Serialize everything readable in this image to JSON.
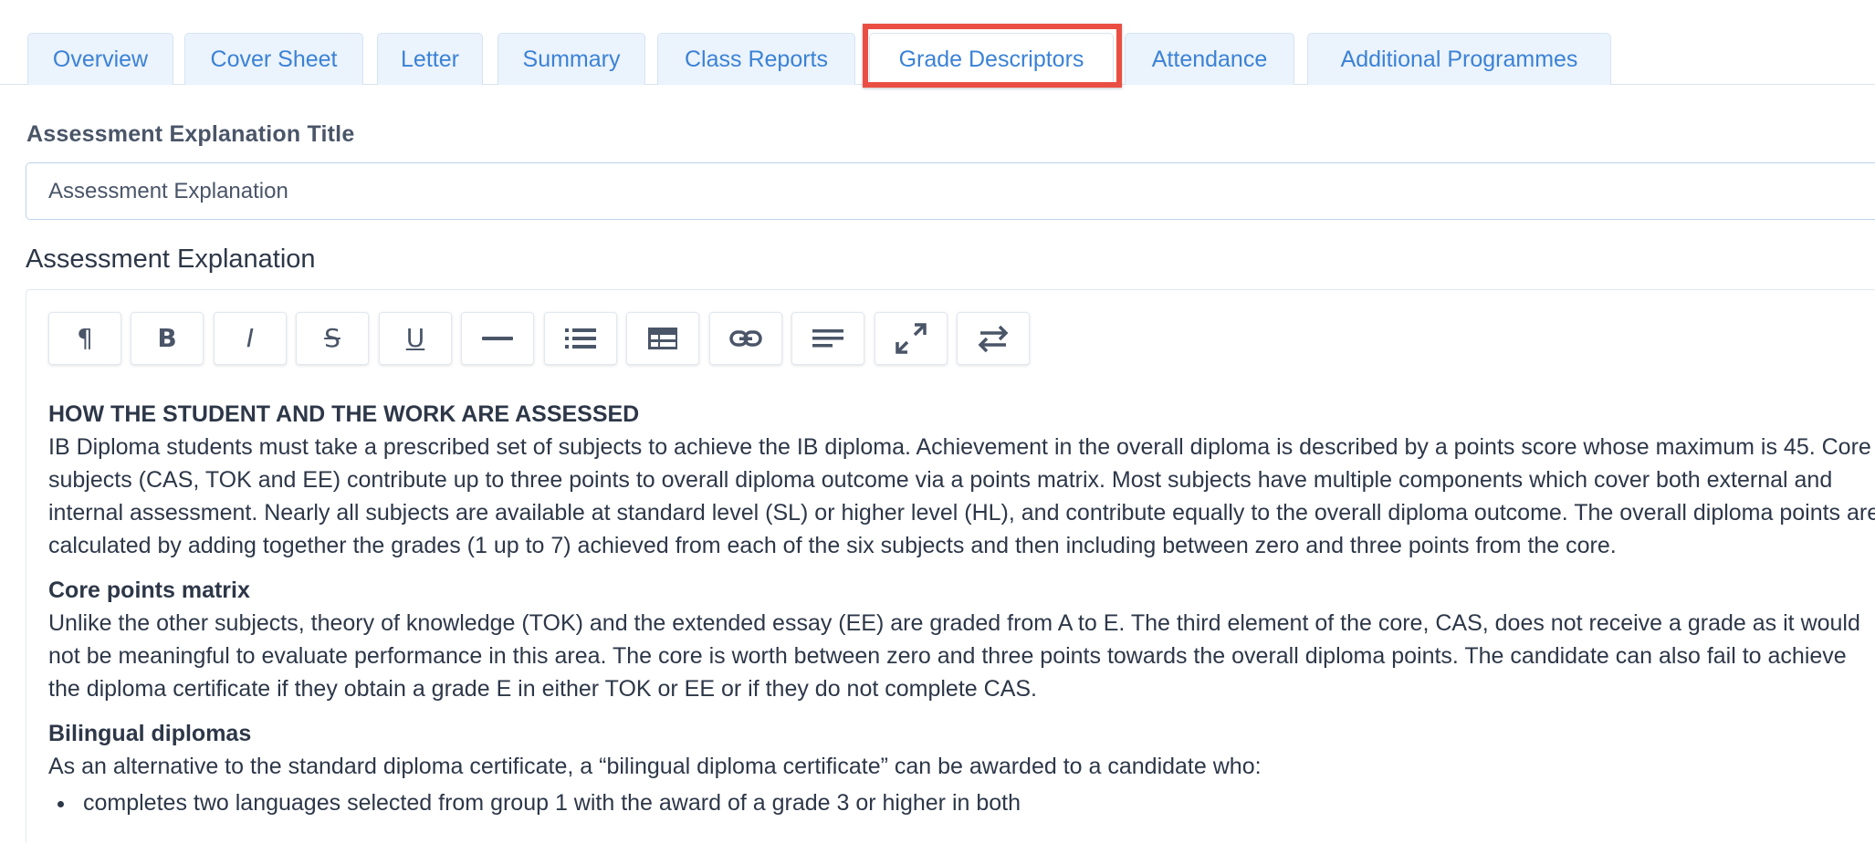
{
  "tabs": [
    {
      "label": "Overview",
      "active": false
    },
    {
      "label": "Cover Sheet",
      "active": false
    },
    {
      "label": "Letter",
      "active": false
    },
    {
      "label": "Summary",
      "active": false
    },
    {
      "label": "Class Reports",
      "active": false
    },
    {
      "label": "Grade Descriptors",
      "active": true
    },
    {
      "label": "Attendance",
      "active": false
    },
    {
      "label": "Additional Programmes",
      "active": false
    }
  ],
  "form": {
    "title_label": "Assessment Explanation Title",
    "title_value": "Assessment Explanation",
    "editor_label": "Assessment Explanation"
  },
  "toolbar": {
    "buttons": [
      {
        "name": "paragraph",
        "icon": "pilcrow-icon",
        "glyph": "¶"
      },
      {
        "name": "bold",
        "icon": "bold-icon",
        "glyph": "B"
      },
      {
        "name": "italic",
        "icon": "italic-icon",
        "glyph": "I"
      },
      {
        "name": "strikethrough",
        "icon": "strikethrough-icon",
        "glyph": "S"
      },
      {
        "name": "underline",
        "icon": "underline-icon",
        "glyph": "U"
      },
      {
        "name": "horizontal-rule",
        "icon": "horizontal-rule-icon",
        "glyph": ""
      },
      {
        "name": "bullet-list",
        "icon": "bullet-list-icon",
        "glyph": ""
      },
      {
        "name": "table",
        "icon": "table-icon",
        "glyph": ""
      },
      {
        "name": "link",
        "icon": "link-icon",
        "glyph": ""
      },
      {
        "name": "align",
        "icon": "align-left-icon",
        "glyph": ""
      },
      {
        "name": "fullscreen",
        "icon": "expand-icon",
        "glyph": ""
      },
      {
        "name": "toggle-source",
        "icon": "swap-arrows-icon",
        "glyph": ""
      }
    ]
  },
  "content": {
    "heading1": "HOW THE STUDENT AND THE WORK ARE ASSESSED",
    "para1": "IB Diploma students must take a prescribed set of subjects to achieve the IB diploma. Achievement in the overall diploma is described by a points score whose maximum is 45. Core subjects (CAS, TOK and EE) contribute up to three points to overall diploma outcome via a points matrix. Most subjects have multiple components which cover both external and internal assessment. Nearly all subjects are available at standard level (SL) or higher level (HL), and contribute equally to the overall diploma outcome. The overall diploma points are calculated by adding together the grades (1 up to 7) achieved from each of the six subjects and then including between zero and three points from the core.",
    "heading2": "Core points matrix",
    "para2": "Unlike the other subjects, theory of knowledge (TOK) and the extended essay (EE) are graded from A to E. The third element of the core, CAS, does not receive a grade as it would not be meaningful to evaluate performance in this area. The core is worth between zero and three points towards the overall diploma points. The candidate can also fail to achieve the diploma certificate if they obtain a grade E in either TOK or EE or if they do not complete CAS.",
    "heading3": "Bilingual diplomas",
    "para3": "As an alternative to the standard diploma certificate, a “bilingual diploma certificate” can be awarded to a candidate who:",
    "bullets": [
      "completes two languages selected from group 1 with the award of a grade 3 or higher in both"
    ]
  },
  "colors": {
    "tab_text": "#3b82d6",
    "tab_bg": "#ebf3fc",
    "highlight": "#ea4e43",
    "text": "#2d3748",
    "label": "#4a5568"
  }
}
